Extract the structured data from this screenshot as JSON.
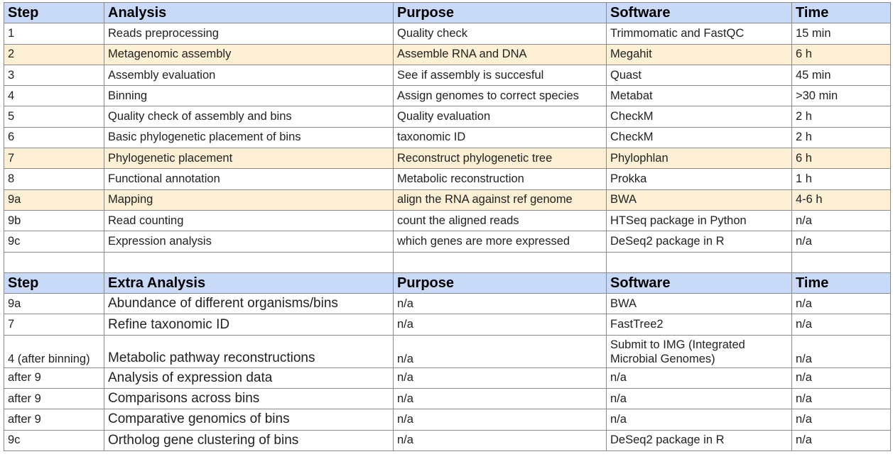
{
  "table1": {
    "headers": [
      "Step",
      "Analysis",
      "Purpose",
      "Software",
      "Time"
    ],
    "rows": [
      [
        "1",
        "Reads preprocessing",
        "Quality check",
        "Trimmomatic and FastQC",
        "15 min"
      ],
      [
        "2",
        "Metagenomic assembly",
        "Assemble RNA and DNA",
        "Megahit",
        "6 h"
      ],
      [
        "3",
        "Assembly evaluation",
        "See if assembly is succesful",
        "Quast",
        "45 min"
      ],
      [
        "4",
        "Binning",
        "Assign genomes to correct species",
        "Metabat",
        ">30 min"
      ],
      [
        "5",
        "Quality check of assembly and bins",
        "Quality evaluation",
        "CheckM",
        "2 h"
      ],
      [
        "6",
        "Basic phylogenetic placement of bins",
        "taxonomic ID",
        "CheckM",
        "2 h"
      ],
      [
        "7",
        "Phylogenetic placement",
        "Reconstruct phylogenetic tree",
        "Phylophlan",
        "6 h"
      ],
      [
        "8",
        "Functional annotation",
        "Metabolic reconstruction",
        "Prokka",
        "1 h"
      ],
      [
        "9a",
        "Mapping",
        "align the RNA against ref genome",
        "BWA",
        "4-6 h"
      ],
      [
        "9b",
        "Read counting",
        "count the aligned reads",
        "HTSeq package in Python",
        "n/a"
      ],
      [
        "9c",
        "Expression analysis",
        "which genes are more expressed",
        "DeSeq2 package in R",
        "n/a"
      ]
    ],
    "highlight_rows": [
      1,
      6,
      8
    ],
    "highlight_color": "#fdf0d4"
  },
  "table2": {
    "headers": [
      "Step",
      "Extra Analysis",
      "Purpose",
      "Software",
      "Time"
    ],
    "rows": [
      [
        "9a",
        "Abundance of different organisms/bins",
        "n/a",
        "BWA",
        "n/a"
      ],
      [
        "7",
        "Refine taxonomic ID",
        "n/a",
        "FastTree2",
        "n/a"
      ],
      [
        "4 (after binning)",
        "Metabolic pathway reconstructions",
        "n/a",
        "Submit to IMG (Integrated Microbial Genomes)",
        "n/a"
      ],
      [
        "after 9",
        "Analysis of expression data",
        "n/a",
        "n/a",
        "n/a"
      ],
      [
        "after 9",
        "Comparisons across bins",
        "n/a",
        "n/a",
        "n/a"
      ],
      [
        "after 9",
        "Comparative genomics of bins",
        "n/a",
        "n/a",
        "n/a"
      ],
      [
        "9c",
        "Ortholog gene clustering of bins",
        "n/a",
        "DeSeq2 package in R",
        "n/a"
      ]
    ]
  },
  "colors": {
    "header_bg": "#c9daf8",
    "grid": "#8a8a8a"
  }
}
